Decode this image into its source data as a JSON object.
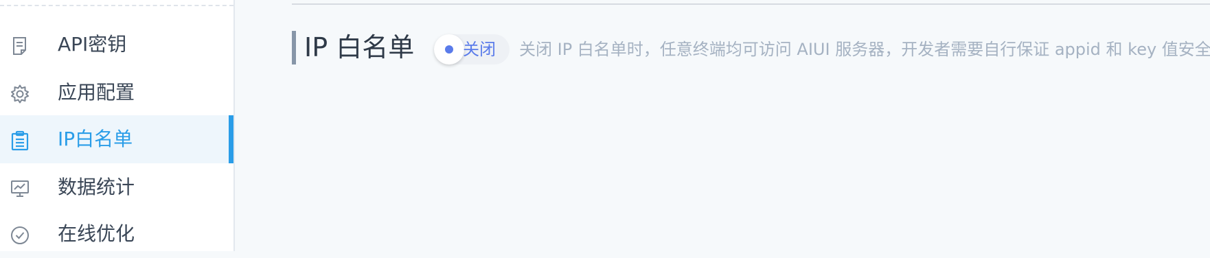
{
  "sidebar": {
    "items": [
      {
        "label": "API密钥",
        "icon": "document-icon"
      },
      {
        "label": "应用配置",
        "icon": "gear-icon"
      },
      {
        "label": "IP白名单",
        "icon": "clipboard-icon",
        "active": true
      },
      {
        "label": "数据统计",
        "icon": "monitor-chart-icon"
      },
      {
        "label": "在线优化",
        "icon": "check-circle-icon"
      }
    ]
  },
  "main": {
    "title": "IP 白名单",
    "toggle": {
      "label": "关闭",
      "state": "off"
    },
    "hint": "关闭 IP 白名单时，任意终端均可访问 AIUI 服务器，开发者需要自行保证 appid 和 key 值安全"
  },
  "colors": {
    "accent": "#2a9de8",
    "toggle_accent": "#5a7bea",
    "active_bg": "#eef6fc",
    "hint_text": "#a5b2c2"
  }
}
